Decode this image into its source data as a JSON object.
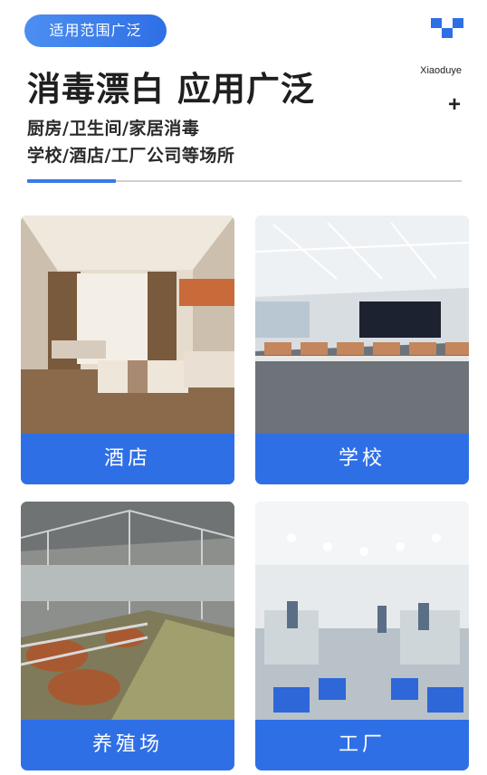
{
  "header": {
    "tag_label": "适用范围广泛",
    "brand": "Xiaoduye",
    "plus": "+",
    "title": "消毒漂白 应用广泛",
    "subtitle_line1": "厨房/卫生间/家居消毒",
    "subtitle_line2": "学校/酒店/工厂公司等场所"
  },
  "cards": [
    {
      "label": "酒店"
    },
    {
      "label": "学校"
    },
    {
      "label": "养殖场"
    },
    {
      "label": "工厂"
    }
  ],
  "colors": {
    "accent": "#2f6fe6",
    "divider": "#cfcfcf"
  }
}
